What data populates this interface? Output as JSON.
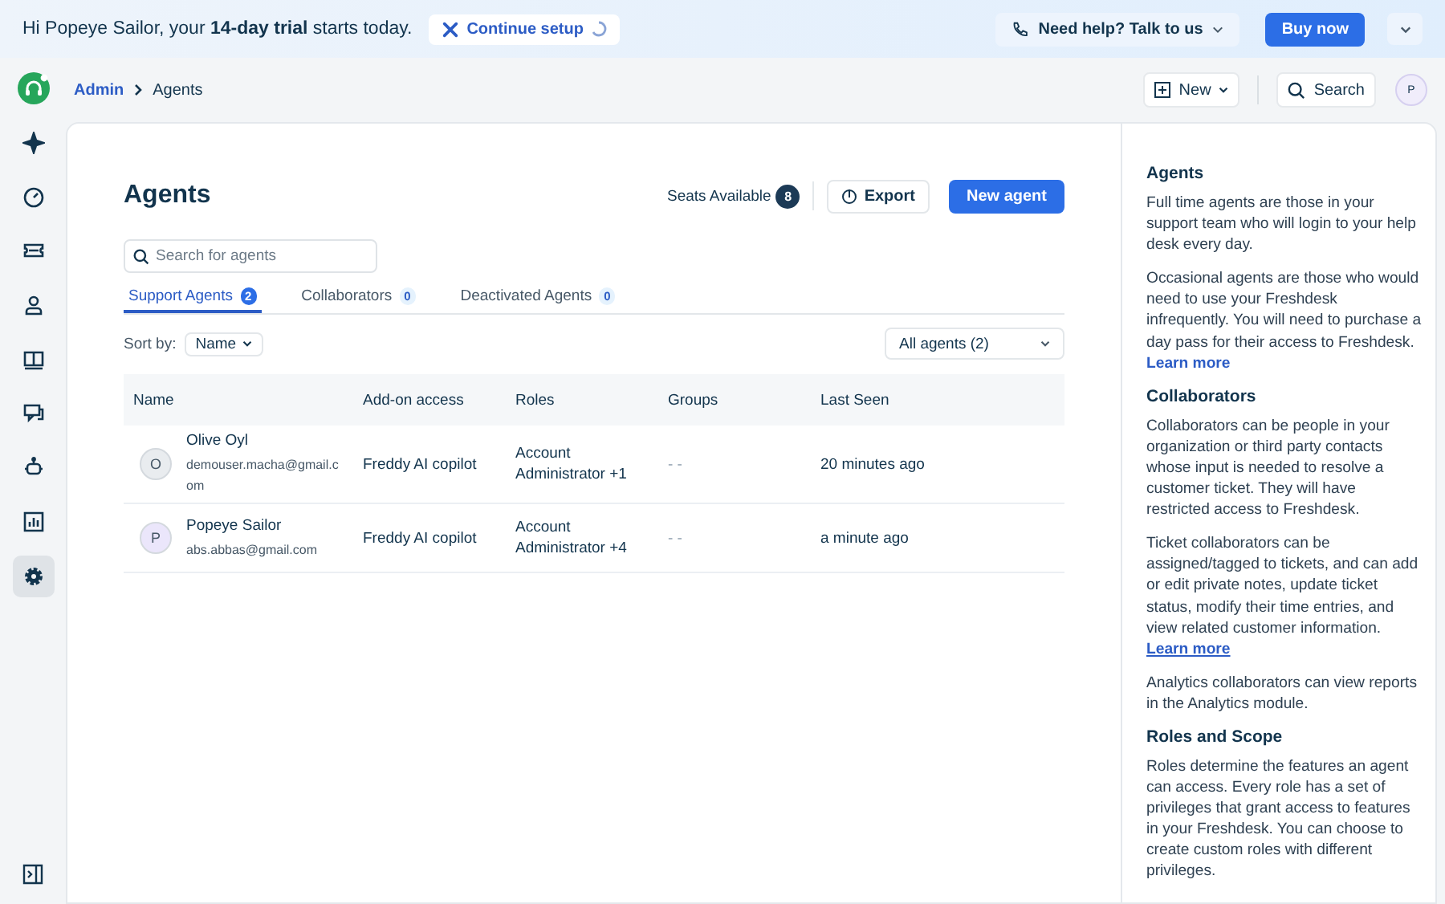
{
  "banner": {
    "greeting": "Hi Popeye Sailor, your **14-day trial** starts today.",
    "setup_button": "Continue setup",
    "help_button": "Need help? Talk to us",
    "buy_button": "Buy now"
  },
  "header": {
    "breadcrumb": [
      "Admin",
      "Agents"
    ],
    "new_button": "New",
    "search_button": "Search",
    "avatar": "P"
  },
  "sidebar": {
    "items": [
      {
        "selected": false
      },
      {
        "selected": false
      },
      {
        "selected": false
      },
      {
        "selected": false
      },
      {
        "selected": false
      },
      {
        "selected": false
      },
      {
        "selected": false
      },
      {
        "selected": false
      },
      {
        "selected": true
      }
    ]
  },
  "page": {
    "title": "Agents",
    "seats_label": "Seats Available",
    "seats_count": "8",
    "export_button": "Export",
    "new_agent_button": "New agent",
    "search": {
      "placeholder": "Search for agents"
    },
    "tabs": [
      {
        "label": "Support Agents",
        "count": "2",
        "selected": true
      },
      {
        "label": "Collaborators",
        "count": "0",
        "selected": false
      },
      {
        "label": "Deactivated Agents",
        "count": "0",
        "selected": false
      }
    ],
    "sort_label": "Sort by:",
    "sort_value": "Name",
    "filter": "All agents (2)"
  },
  "table": {
    "columns": [
      "Name",
      "Add-on access",
      "Roles",
      "Groups",
      "Last Seen"
    ],
    "rows": [
      {
        "initial": "O",
        "color": "#e9ecef",
        "name": "Olive Oyl",
        "email": "demouser.macha@gmail.com",
        "addon": "Freddy AI copilot",
        "roles": "Account Administrator +1",
        "groups": "- -",
        "last_seen": "20 minutes ago"
      },
      {
        "initial": "P",
        "color": "#ebe6fb",
        "name": "Popeye Sailor",
        "email": "abs.abbas@gmail.com",
        "addon": "Freddy AI copilot",
        "roles": "Account Administrator +4",
        "groups": "- -",
        "last_seen": "a minute ago"
      }
    ]
  },
  "help_panel": [
    {
      "heading": "Agents",
      "paragraphs": [
        {
          "text": "Full time agents are those in your support team who will login to your help desk every day."
        },
        {
          "text": "Occasional agents are those who would need to use your Freshdesk infrequently. You will need to purchase a day pass for their access to Freshdesk.",
          "link": "Learn more",
          "hovered": false
        }
      ]
    },
    {
      "heading": "Collaborators",
      "paragraphs": [
        {
          "text": "Collaborators can be people in your organization or third party contacts whose input is needed to resolve a customer ticket. They will have restricted access to Freshdesk."
        },
        {
          "text": "Ticket collaborators can be assigned/tagged to tickets, and can add or edit private notes, update ticket status, modify their time entries, and view related customer information.",
          "link": "Learn more",
          "hovered": true
        },
        {
          "text": "Analytics collaborators can view reports in the Analytics module."
        }
      ]
    },
    {
      "heading": "Roles and Scope",
      "paragraphs": [
        {
          "text": "Roles determine the features an agent can access. Every role has a set of privileges that grant access to features in your Freshdesk. You can choose to create custom roles with different privileges."
        }
      ]
    }
  ]
}
